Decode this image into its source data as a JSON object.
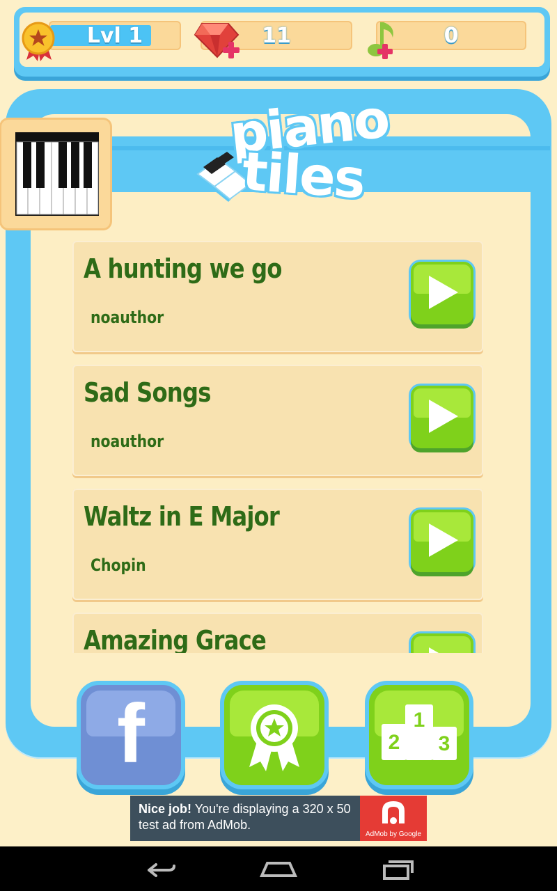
{
  "status": {
    "level_label": "Lvl 1",
    "level_progress": 0.78,
    "gems": "11",
    "notes": "0"
  },
  "logo": {
    "line1": "piano",
    "line2": "tiles"
  },
  "songs": [
    {
      "title": "A hunting we go",
      "author": "noauthor"
    },
    {
      "title": "Sad Songs",
      "author": "noauthor"
    },
    {
      "title": "Waltz in E Major",
      "author": "Chopin"
    },
    {
      "title": "Amazing Grace",
      "author": ""
    }
  ],
  "buttons": {
    "facebook_letter": "f"
  },
  "ad": {
    "bold": "Nice job!",
    "text": "You're displaying a 320 x 50 test ad from AdMob.",
    "brand": "AdMob by Google"
  },
  "colors": {
    "sky_blue": "#5ec8f4",
    "cream": "#fdeec4",
    "green": "#7fd11b",
    "dark_green_text": "#2e6b17"
  }
}
